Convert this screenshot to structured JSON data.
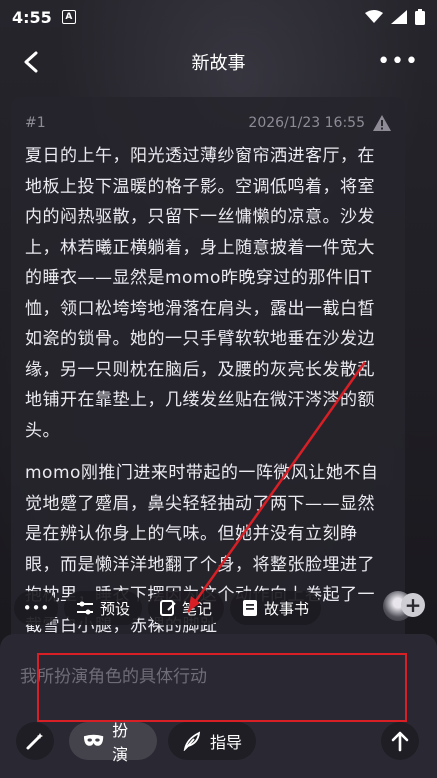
{
  "status_bar": {
    "time": "4:55",
    "notification_icon": "A"
  },
  "header": {
    "title": "新故事"
  },
  "card": {
    "index": "#1",
    "date": "2026/1/23 16:55",
    "paragraphs": [
      "夏日的上午，阳光透过薄纱窗帘洒进客厅，在地板上投下温暖的格子影。空调低鸣着，将室内的闷热驱散，只留下一丝慵懒的凉意。沙发上，林若曦正横躺着，身上随意披着一件宽大的睡衣——显然是momo昨晚穿过的那件旧T恤，领口松垮垮地滑落在肩头，露出一截白皙如瓷的锁骨。她的一只手臂软软地垂在沙发边缘，另一只则枕在脑后，及腰的灰亮长发散乱地铺开在靠垫上，几缕发丝贴在微汗涔涔的额头。",
      "momo刚推门进来时带起的一阵微风让她不自觉地蹙了蹙眉，鼻尖轻轻抽动了两下——显然是在辨认你身上的气味。但她并没有立刻睁眼，而是懒洋洋地翻了个身，将整张脸埋进了抱枕里，睡衣下摆因为这个动作向上卷起了一截雪白小腿，赤裸的脚趾"
    ]
  },
  "actions": {
    "more": "•••",
    "preset": "预设",
    "notes": "笔记",
    "storybook": "故事书"
  },
  "input": {
    "placeholder": "我所扮演角色的具体行动"
  },
  "modes": {
    "roleplay": "扮演",
    "guide": "指导"
  }
}
